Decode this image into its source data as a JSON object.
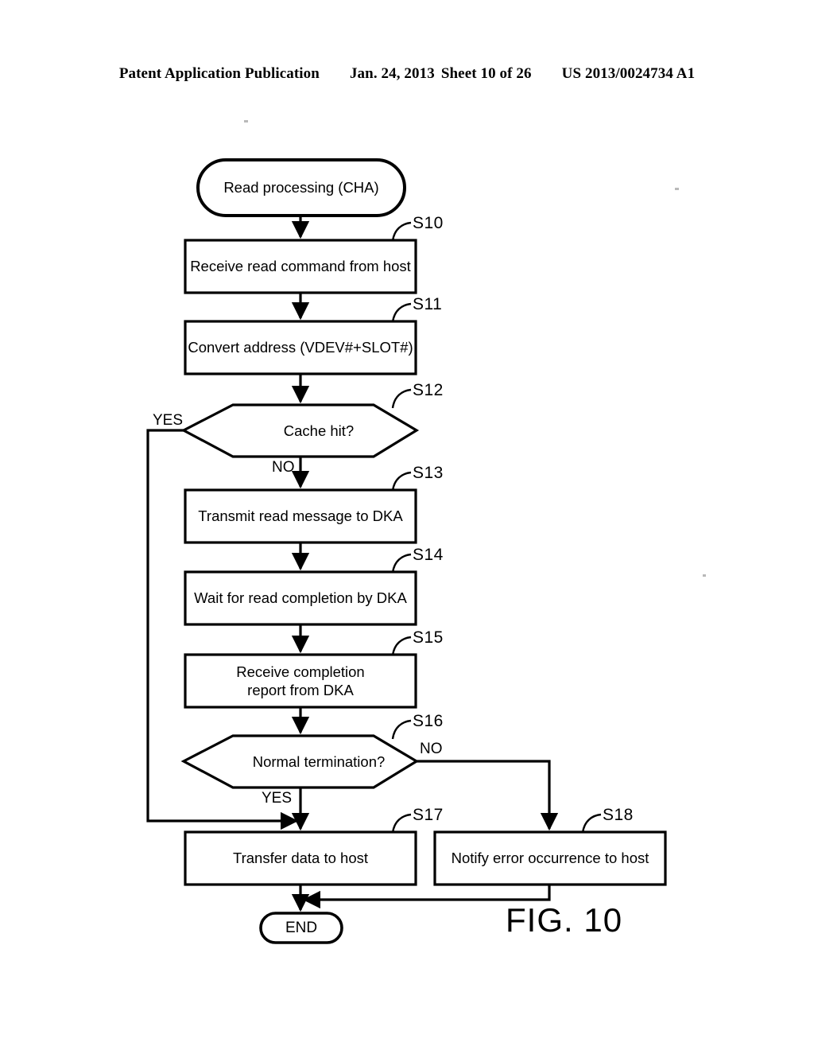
{
  "header": {
    "publication": "Patent Application Publication",
    "date": "Jan. 24, 2013",
    "sheet": "Sheet 10 of 26",
    "number": "US 2013/0024734 A1"
  },
  "figure": {
    "caption": "FIG. 10"
  },
  "flowchart": {
    "start": {
      "label": "Read processing (CHA)"
    },
    "end": {
      "label": "END"
    },
    "steps": [
      {
        "id": "S10",
        "label": "Receive read command from host",
        "shape": "process"
      },
      {
        "id": "S11",
        "label": "Convert address (VDEV#+SLOT#)",
        "shape": "process"
      },
      {
        "id": "S12",
        "label": "Cache hit?",
        "shape": "decision"
      },
      {
        "id": "S13",
        "label": "Transmit read message to DKA",
        "shape": "process"
      },
      {
        "id": "S14",
        "label": "Wait for read completion by DKA",
        "shape": "process"
      },
      {
        "id": "S15",
        "label_line1": "Receive completion",
        "label_line2": "report from DKA",
        "shape": "process"
      },
      {
        "id": "S16",
        "label": "Normal termination?",
        "shape": "decision"
      },
      {
        "id": "S17",
        "label": "Transfer data to host",
        "shape": "process"
      },
      {
        "id": "S18",
        "label": "Notify error occurrence to host",
        "shape": "process"
      }
    ],
    "branches": {
      "s12_yes": "YES",
      "s12_no": "NO",
      "s16_yes": "YES",
      "s16_no": "NO"
    }
  },
  "colors": {
    "ink": "#000000",
    "paper": "#ffffff"
  }
}
